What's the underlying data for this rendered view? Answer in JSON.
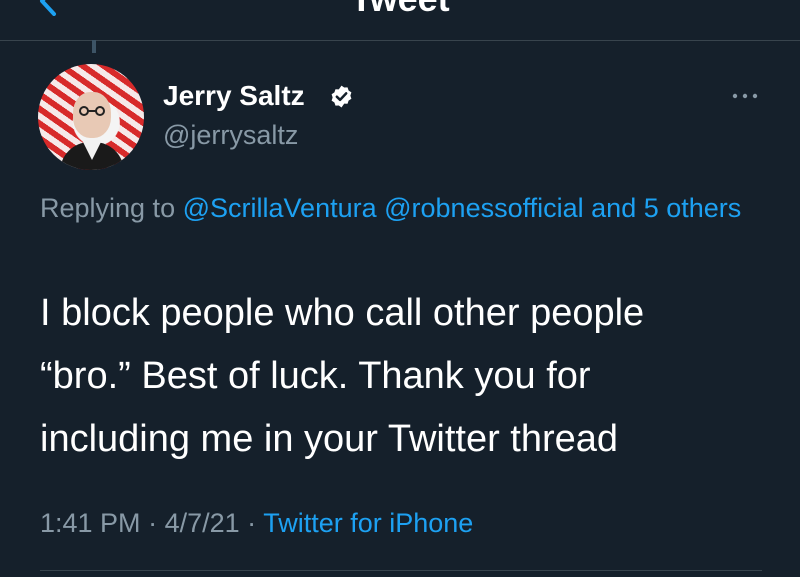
{
  "header": {
    "title": "Tweet"
  },
  "author": {
    "name": "Jerry Saltz",
    "handle": "@jerrysaltz"
  },
  "reply": {
    "prefix": "Replying to",
    "mentions": [
      "@ScrillaVentura",
      "@robnessofficial"
    ],
    "others": "and 5 others"
  },
  "tweet": {
    "lines": [
      "I block people who call other people",
      "“bro.”  Best of luck. Thank you for",
      "including me in your Twitter thread"
    ]
  },
  "meta": {
    "time": "1:41 PM",
    "date": "4/7/21",
    "source": "Twitter for iPhone"
  },
  "colors": {
    "background": "#15202b",
    "accent": "#1da1f2",
    "secondary_text": "#8899a6"
  },
  "icons": [
    "back-arrow-icon",
    "verified-badge-icon",
    "more-options-icon"
  ]
}
